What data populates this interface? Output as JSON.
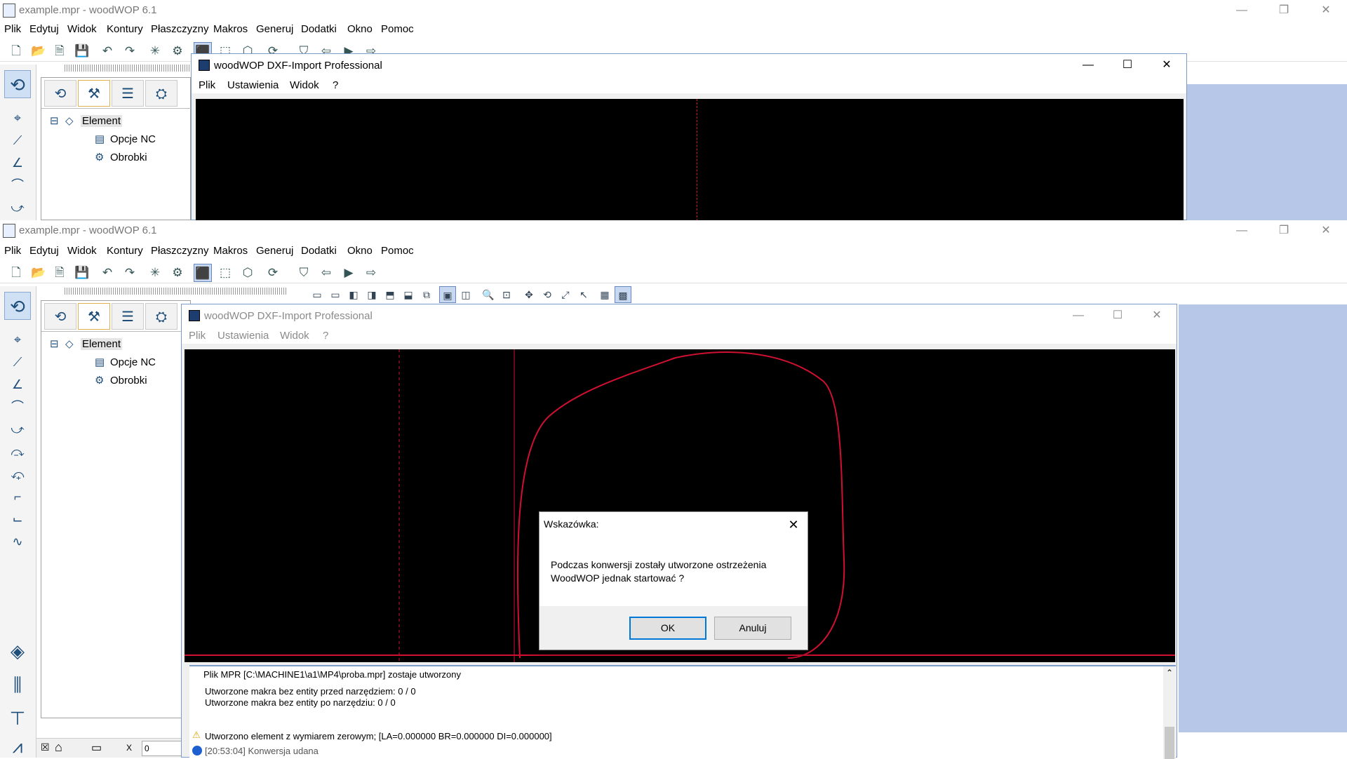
{
  "app": {
    "title": "example.mpr - woodWOP 6.1",
    "window_controls": {
      "minimize": "—",
      "restore": "❐",
      "close": "✕"
    },
    "menu": [
      "Plik",
      "Edytuj",
      "Widok",
      "Kontury",
      "Płaszczyzny",
      "Makros",
      "Generuj",
      "Dodatki",
      "Okno",
      "Pomoc"
    ]
  },
  "tree": {
    "root": "Element",
    "children": [
      "Opcje NC",
      "Obrobki"
    ]
  },
  "dxf": {
    "title": "woodWOP DXF-Import Professional",
    "menu": [
      "Plik",
      "Ustawienia",
      "Widok",
      "?"
    ],
    "controls": {
      "minimize": "—",
      "maximize": "☐",
      "close": "✕"
    }
  },
  "log": {
    "lines": [
      "Plik MPR [C:\\MACHINE1\\a1\\MP4\\proba.mpr] zostaje utworzony",
      "Utworzone makra bez entity przed narzędziem: 0 / 0",
      "Utworzone makra bez entity po narzędziu: 0 / 0",
      "Utworzono element z wymiarem zerowym; [LA=0.000000  BR=0.000000  DI=0.000000]",
      "[20:53:04] Konwersja udana"
    ]
  },
  "dialog": {
    "title": "Wskazówka:",
    "message_line1": "Podczas konwersji zostały utworzone ostrzeżenia",
    "message_line2": "WoodWOP jednak startować ?",
    "ok": "OK",
    "cancel": "Anuluj",
    "close": "✕"
  },
  "bottom_strip": {
    "x_label": "X",
    "x_value": "0"
  },
  "colors": {
    "contour": "#d01030",
    "canvas": "#000000",
    "accent": "#0078d7"
  }
}
